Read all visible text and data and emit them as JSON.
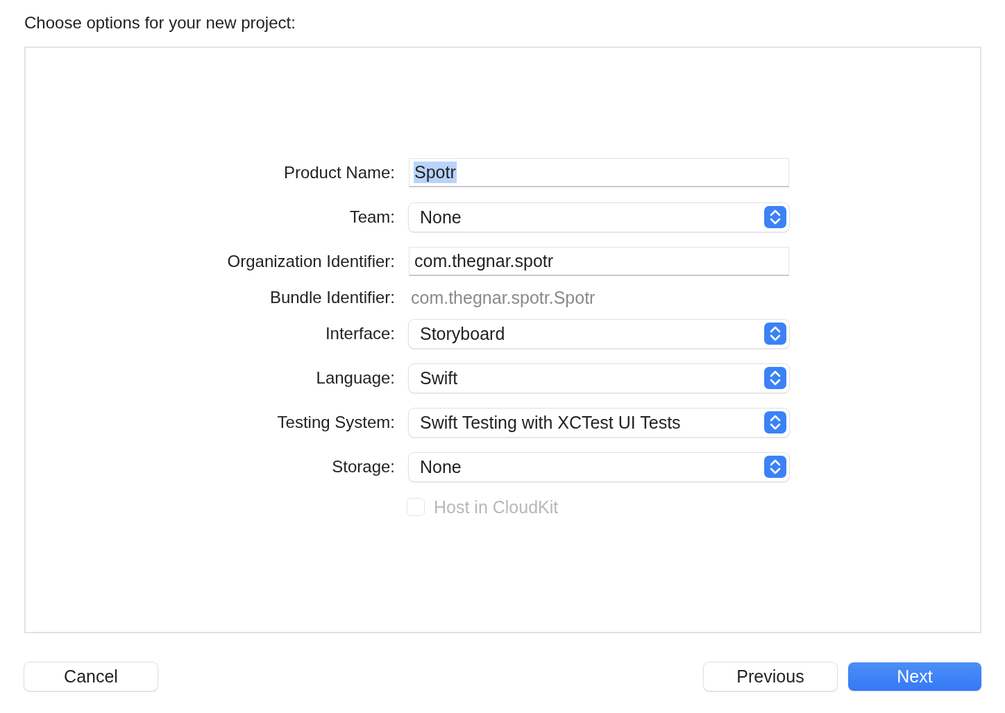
{
  "heading": "Choose options for your new project:",
  "form": [
    {
      "kind": "field",
      "label": "Product Name:",
      "value": "Spotr",
      "text_selected": true
    },
    {
      "kind": "popup",
      "label": "Team:",
      "value": "None"
    },
    {
      "kind": "field",
      "label": "Organization Identifier:",
      "value": "com.thegnar.spotr",
      "text_selected": false
    },
    {
      "kind": "static",
      "label": "Bundle Identifier:",
      "value": "com.thegnar.spotr.Spotr"
    },
    {
      "kind": "popup",
      "label": "Interface:",
      "value": "Storyboard"
    },
    {
      "kind": "popup",
      "label": "Language:",
      "value": "Swift"
    },
    {
      "kind": "popup",
      "label": "Testing System:",
      "value": "Swift Testing with XCTest UI Tests"
    },
    {
      "kind": "popup",
      "label": "Storage:",
      "value": "None"
    },
    {
      "kind": "checkbox",
      "label": "Host in CloudKit",
      "checked": false,
      "disabled": true
    }
  ],
  "buttons": [
    {
      "label": "Cancel",
      "primary": false
    },
    {
      "label": "Previous",
      "primary": false
    },
    {
      "label": "Next",
      "primary": true
    }
  ]
}
